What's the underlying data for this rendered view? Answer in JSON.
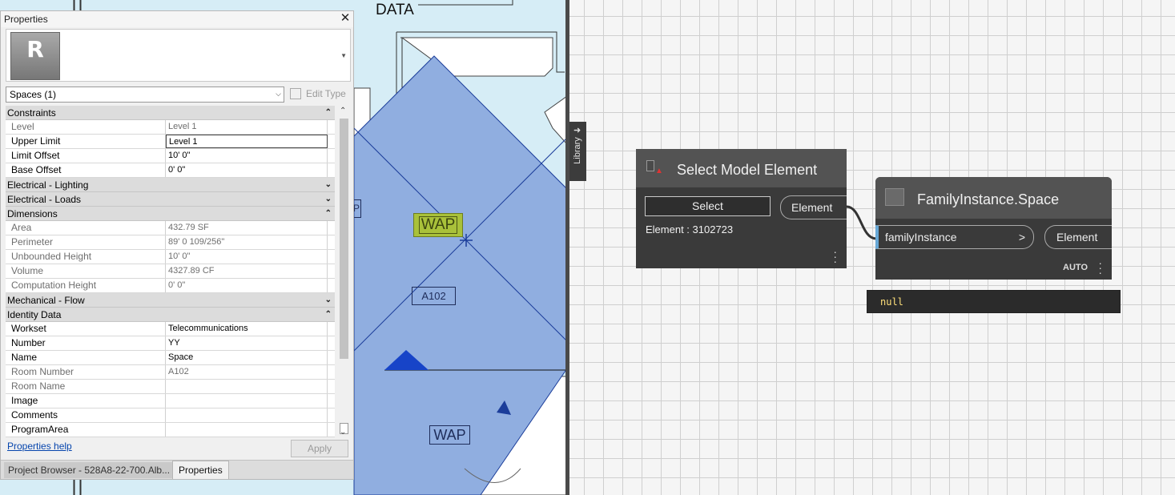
{
  "revit_view": {
    "data_label": "DATA",
    "wap_tag_1": "WAP",
    "wap_tag_2": "WAP",
    "room_tag": "A102",
    "partial_tag": "P",
    "space_fill_color": "#90aee0",
    "background_color": "#d6edf6"
  },
  "properties_palette": {
    "title": "Properties",
    "close_icon": "close-icon",
    "logo_letter": "R",
    "type_selector": "Spaces (1)",
    "edit_type_label": "Edit Type",
    "groups": [
      {
        "name": "Constraints",
        "chevron": "⌃",
        "rows": [
          {
            "name": "Level",
            "value": "Level 1",
            "readonly": true
          },
          {
            "name": "Upper Limit",
            "value": "Level 1",
            "readonly": false,
            "editing": true
          },
          {
            "name": "Limit Offset",
            "value": "10'  0\"",
            "readonly": false
          },
          {
            "name": "Base Offset",
            "value": "0'  0\"",
            "readonly": false
          }
        ]
      },
      {
        "name": "Electrical - Lighting",
        "chevron": "⌄",
        "rows": []
      },
      {
        "name": "Electrical - Loads",
        "chevron": "⌄",
        "rows": []
      },
      {
        "name": "Dimensions",
        "chevron": "⌃",
        "rows": [
          {
            "name": "Area",
            "value": "432.79 SF",
            "readonly": true
          },
          {
            "name": "Perimeter",
            "value": "89'  0 109/256\"",
            "readonly": true
          },
          {
            "name": "Unbounded Height",
            "value": "10'  0\"",
            "readonly": true
          },
          {
            "name": "Volume",
            "value": "4327.89 CF",
            "readonly": true
          },
          {
            "name": "Computation Height",
            "value": "0'  0\"",
            "readonly": true
          }
        ]
      },
      {
        "name": "Mechanical - Flow",
        "chevron": "⌄",
        "rows": []
      },
      {
        "name": "Identity Data",
        "chevron": "⌃",
        "rows": [
          {
            "name": "Workset",
            "value": "Telecommunications",
            "readonly": false
          },
          {
            "name": "Number",
            "value": "YY",
            "readonly": false
          },
          {
            "name": "Name",
            "value": "Space",
            "readonly": false
          },
          {
            "name": "Room Number",
            "value": "A102",
            "readonly": true
          },
          {
            "name": "Room Name",
            "value": "",
            "readonly": true
          },
          {
            "name": "Image",
            "value": "",
            "readonly": false
          },
          {
            "name": "Comments",
            "value": "",
            "readonly": false
          },
          {
            "name": "ProgramArea",
            "value": "",
            "readonly": false
          }
        ]
      }
    ],
    "help_link": "Properties help",
    "apply_label": "Apply",
    "tabs": [
      "Project Browser - 528A8-22-700.Alb...",
      "Properties"
    ]
  },
  "dynamo": {
    "library_label": "Library",
    "select_node": {
      "title": "Select Model Element",
      "button": "Select",
      "output_port": "Element",
      "status": "Element : 3102723"
    },
    "space_node": {
      "title": "FamilyInstance.Space",
      "input_port": "familyInstance",
      "input_arrow": ">",
      "output_port": "Element",
      "lacing": "AUTO",
      "preview": "null"
    }
  }
}
